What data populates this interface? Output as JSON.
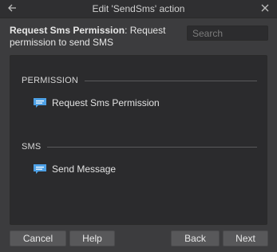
{
  "window": {
    "title": "Edit 'SendSms' action"
  },
  "header": {
    "name": "Request Sms Permission",
    "separator": ": ",
    "description": "Request permission to send SMS"
  },
  "search": {
    "placeholder": "Search"
  },
  "sections": [
    {
      "title": "PERMISSION",
      "items": [
        {
          "label": "Request Sms Permission",
          "icon": "chat-bubble-icon"
        }
      ]
    },
    {
      "title": "SMS",
      "items": [
        {
          "label": "Send Message",
          "icon": "chat-bubble-icon"
        }
      ]
    }
  ],
  "buttons": {
    "cancel": "Cancel",
    "help": "Help",
    "back": "Back",
    "next": "Next"
  },
  "colors": {
    "dialog_bg": "#3c3c3e",
    "panel_bg": "#2b2b2d",
    "button_bg": "#58585a",
    "icon_blue": "#4ea1e6"
  }
}
